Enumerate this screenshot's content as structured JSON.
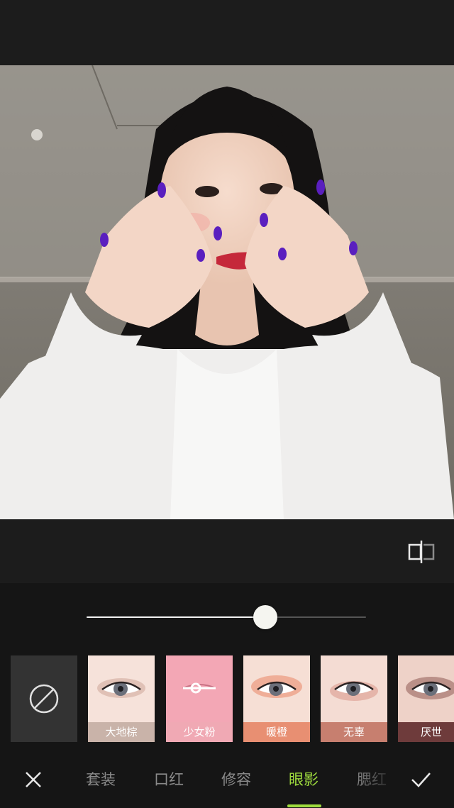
{
  "colors": {
    "accent": "#9fdc3e",
    "background": "#1c1c1c",
    "panel": "#151515"
  },
  "photo": {
    "description_icon": "portrait-photo"
  },
  "compare": {
    "icon": "compare-icon"
  },
  "intensity_slider": {
    "value": 0.64
  },
  "swatches": [
    {
      "label": "",
      "icon": "none-icon",
      "color": "#333333"
    },
    {
      "label": "大地棕",
      "color": "#c9b3a9"
    },
    {
      "label": "少女粉",
      "color": "#f0a9b4"
    },
    {
      "label": "暖橙",
      "color": "#e88f72"
    },
    {
      "label": "无辜",
      "color": "#c77f6f"
    },
    {
      "label": "厌世",
      "color": "#6e3b3b"
    }
  ],
  "bottom_nav": {
    "close_icon": "close-icon",
    "confirm_icon": "check-icon",
    "tabs": [
      {
        "label": "套装",
        "active": false
      },
      {
        "label": "口红",
        "active": false
      },
      {
        "label": "修容",
        "active": false
      },
      {
        "label": "眼影",
        "active": true
      },
      {
        "label": "腮红",
        "active": false
      }
    ]
  }
}
